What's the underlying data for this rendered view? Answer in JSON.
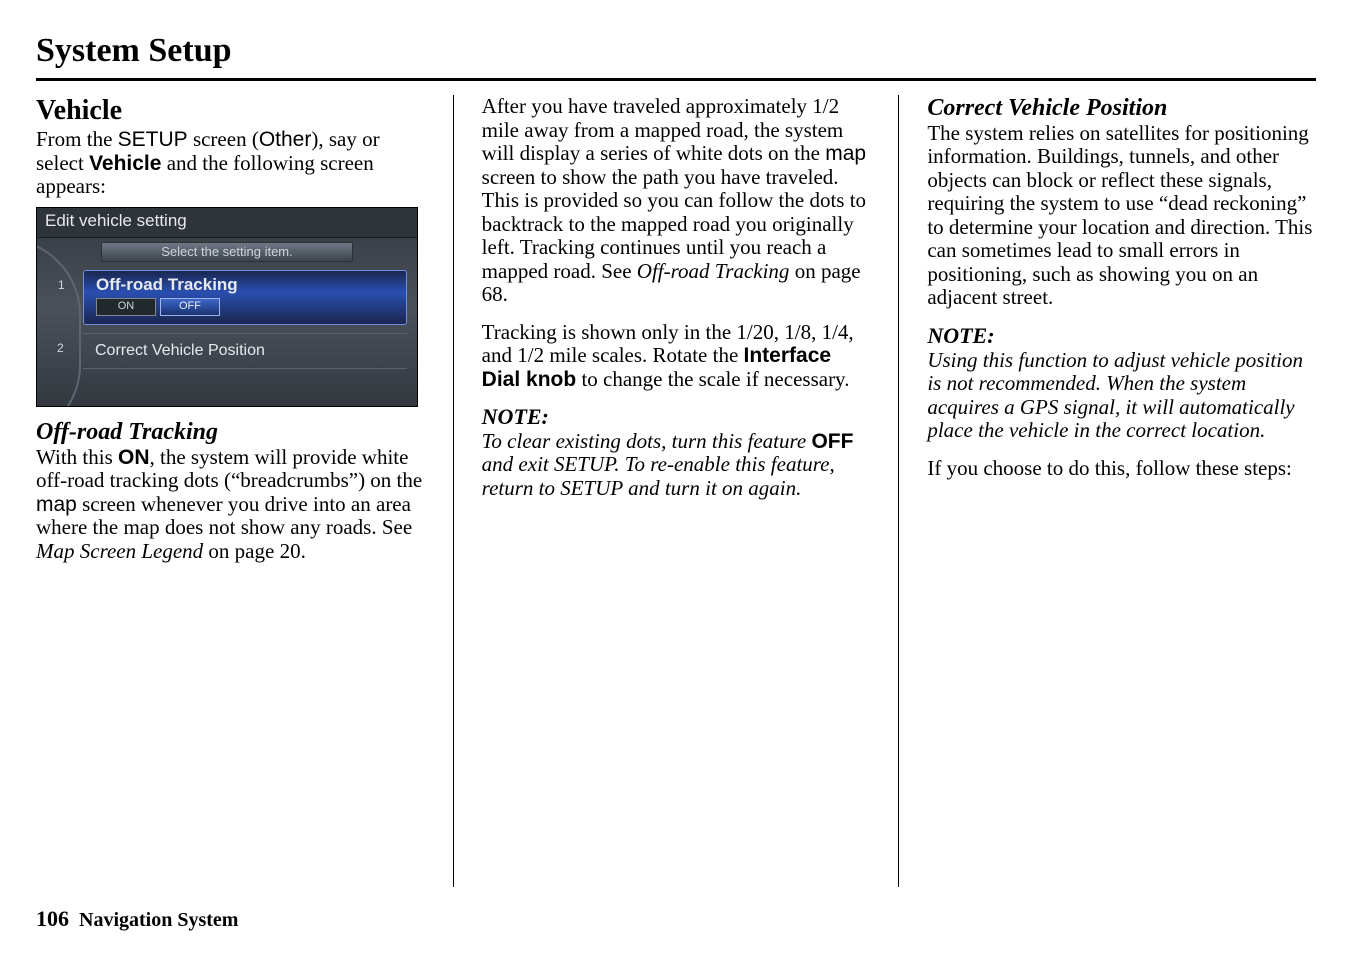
{
  "page": {
    "title": "System Setup",
    "number": "106",
    "footer_label": "Navigation System"
  },
  "col1": {
    "heading": "Vehicle",
    "intro_a": "From the ",
    "intro_setup": "SETUP",
    "intro_b": " screen (",
    "intro_other": "Other",
    "intro_c": "), say or select ",
    "intro_vehicle": "Vehicle",
    "intro_d": " and the following screen appears:",
    "offroad_heading": "Off-road Tracking",
    "p1_a": "With this ",
    "p1_on": "ON",
    "p1_b": ", the system will provide white off-road tracking dots (“breadcrumbs”) on the ",
    "p1_map": "map",
    "p1_c": " screen whenever you drive into an area where the map does not show any roads. See ",
    "p1_ref": "Map Screen Legend",
    "p1_d": " on page 20."
  },
  "nav": {
    "title": "Edit vehicle setting",
    "subtitle": "Select the setting item.",
    "item1_num": "1",
    "item1_label": "Off-road Tracking",
    "item1_on": "ON",
    "item1_off": "OFF",
    "item2_num": "2",
    "item2_label": "Correct Vehicle Position"
  },
  "col2": {
    "p1_a": "After you have traveled approximately 1/2 mile away from a mapped road, the system will display a series of white dots on the ",
    "p1_map": "map",
    "p1_b": " screen to show the path you have traveled. This is provided so you can follow the dots to backtrack to the mapped road you originally left. Tracking continues until you reach a mapped road. See ",
    "p1_ref": "Off-road Tracking",
    "p1_c": " on page 68.",
    "p2_a": "Tracking is shown only in the 1/20, 1/8, 1/4, and 1/2 mile scales. Rotate the ",
    "p2_knob": "Interface Dial knob",
    "p2_b": " to change the scale if necessary.",
    "note_label": "NOTE:",
    "note_a": "To clear existing dots, turn this feature ",
    "note_off": "OFF",
    "note_b": " and exit SETUP. To re-enable this feature, return to SETUP and turn it on again."
  },
  "col3": {
    "heading": "Correct Vehicle Position",
    "p1": "The system relies on satellites for positioning information. Buildings, tunnels, and other objects can block or reflect these signals, requiring the system to use “dead reckoning” to determine your location and direction. This can sometimes lead to small errors in positioning, such as showing you on an adjacent street.",
    "note_label": "NOTE:",
    "note_body": "Using this function to adjust vehicle position is not recommended. When the system acquires a GPS signal, it will automatically place the vehicle in the correct location.",
    "p2": "If you choose to do this, follow these steps:"
  }
}
